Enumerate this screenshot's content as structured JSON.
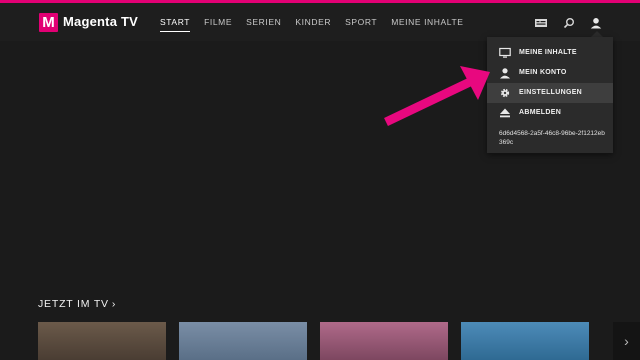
{
  "brand": {
    "logo_letter": "M",
    "name": "Magenta TV",
    "accent": "#e20074"
  },
  "nav": {
    "items": [
      {
        "label": "START",
        "active": true
      },
      {
        "label": "FILME"
      },
      {
        "label": "SERIEN"
      },
      {
        "label": "KINDER"
      },
      {
        "label": "SPORT"
      },
      {
        "label": "MEINE INHALTE"
      }
    ]
  },
  "header_icons": [
    "tv-guide-icon",
    "search-icon",
    "user-icon"
  ],
  "user_menu": {
    "items": [
      {
        "label": "MEINE INHALTE",
        "icon": "monitor-icon"
      },
      {
        "label": "MEIN KONTO",
        "icon": "user-icon"
      },
      {
        "label": "EINSTELLUNGEN",
        "icon": "gear-icon",
        "highlighted": true
      },
      {
        "label": "ABMELDEN",
        "icon": "eject-icon"
      }
    ],
    "device_id": "6d6d4568-2a5f-46c8-96be-2f1212eb369c"
  },
  "annotation": {
    "arrow_color": "#e8087f"
  },
  "section": {
    "title": "JETZT IM TV",
    "chevron": "›"
  },
  "row_next": "›"
}
